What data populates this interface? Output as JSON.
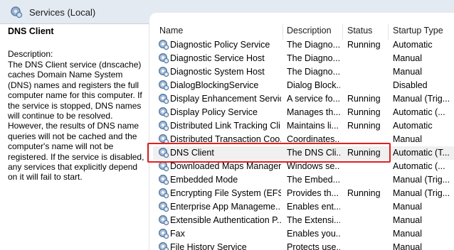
{
  "window": {
    "title": "Services (Local)",
    "title_icon": "gear-icon"
  },
  "detail": {
    "service_name": "DNS Client",
    "description_label": "Description:",
    "description": "The DNS Client service (dnscache) caches Domain Name System (DNS) names and registers the full computer name for this computer. If the service is stopped, DNS names will continue to be resolved. However, the results of DNS name queries will not be cached and the computer's name will not be registered. If the service is disabled, any services that explicitly depend on it will fail to start."
  },
  "columns": {
    "name": "Name",
    "description": "Description",
    "status": "Status",
    "startup": "Startup Type"
  },
  "rows": [
    {
      "name": "Diagnostic Policy Service",
      "description": "The Diagno...",
      "status": "Running",
      "startup": "Automatic"
    },
    {
      "name": "Diagnostic Service Host",
      "description": "The Diagno...",
      "status": "",
      "startup": "Manual"
    },
    {
      "name": "Diagnostic System Host",
      "description": "The Diagno...",
      "status": "",
      "startup": "Manual"
    },
    {
      "name": "DialogBlockingService",
      "description": "Dialog Block...",
      "status": "",
      "startup": "Disabled"
    },
    {
      "name": "Display Enhancement Service",
      "description": "A service fo...",
      "status": "Running",
      "startup": "Manual (Trig..."
    },
    {
      "name": "Display Policy Service",
      "description": "Manages th...",
      "status": "Running",
      "startup": "Automatic (..."
    },
    {
      "name": "Distributed Link Tracking Cli...",
      "description": "Maintains li...",
      "status": "Running",
      "startup": "Automatic"
    },
    {
      "name": "Distributed Transaction Coo...",
      "description": "Coordinates...",
      "status": "",
      "startup": "Manual"
    },
    {
      "name": "DNS Client",
      "description": "The DNS Cli...",
      "status": "Running",
      "startup": "Automatic (T...",
      "selected": true
    },
    {
      "name": "Downloaded Maps Manager",
      "description": "Windows se...",
      "status": "",
      "startup": "Automatic (..."
    },
    {
      "name": "Embedded Mode",
      "description": "The Embed...",
      "status": "",
      "startup": "Manual (Trig..."
    },
    {
      "name": "Encrypting File System (EFS)",
      "description": "Provides th...",
      "status": "Running",
      "startup": "Manual (Trig..."
    },
    {
      "name": "Enterprise App Manageme...",
      "description": "Enables ent...",
      "status": "",
      "startup": "Manual"
    },
    {
      "name": "Extensible Authentication P...",
      "description": "The Extensi...",
      "status": "",
      "startup": "Manual"
    },
    {
      "name": "Fax",
      "description": "Enables you...",
      "status": "",
      "startup": "Manual"
    },
    {
      "name": "File History Service",
      "description": "Protects use...",
      "status": "",
      "startup": "Manual"
    }
  ],
  "colors": {
    "highlight_border": "#e0201f",
    "title_bar": "#e3eaf2"
  },
  "row_icon": "service-gear-icon"
}
